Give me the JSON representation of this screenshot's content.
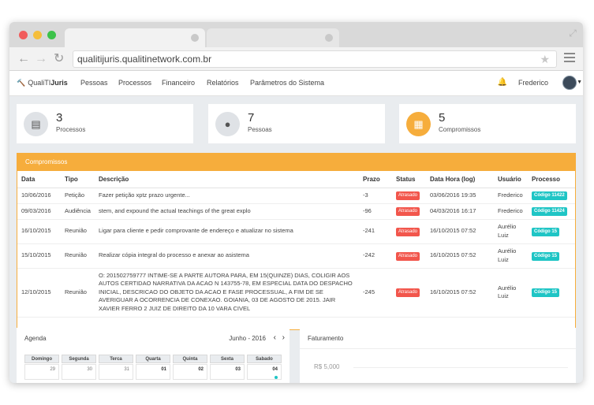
{
  "browser": {
    "url": "qualitijuris.qualitinetwork.com.br"
  },
  "appnav": {
    "brand_prefix": "QualiTI",
    "brand_suffix": "Juris",
    "items": [
      "Pessoas",
      "Processos",
      "Financeiro",
      "Relatórios",
      "Parâmetros do Sistema"
    ],
    "user": "Frederico"
  },
  "cards": [
    {
      "value": "3",
      "label": "Processos",
      "icon": "folder-icon"
    },
    {
      "value": "7",
      "label": "Pessoas",
      "icon": "user-icon"
    },
    {
      "value": "5",
      "label": "Compromissos",
      "icon": "calendar-icon"
    }
  ],
  "compromissos": {
    "title": "Compromissos",
    "columns": [
      "Data",
      "Tipo",
      "Descrição",
      "Prazo",
      "Status",
      "Data Hora (log)",
      "Usuário",
      "Processo"
    ],
    "rows": [
      {
        "data": "10/06/2016",
        "tipo": "Petição",
        "descricao": "Fazer petição xptz prazo urgente...",
        "prazo": "-3",
        "status": "Atrasado",
        "datahora": "03/06/2016 19:35",
        "usuario": "Frederico",
        "processo": "Código 11422"
      },
      {
        "data": "09/03/2016",
        "tipo": "Audiência",
        "descricao": "stem, and expound the actual teachings of the great explo",
        "prazo": "-96",
        "status": "Atrasado",
        "datahora": "04/03/2016 16:17",
        "usuario": "Frederico",
        "processo": "Código 11424"
      },
      {
        "data": "16/10/2015",
        "tipo": "Reunião",
        "descricao": "Ligar para cliente e pedir comprovante de endereço e atualizar no sistema",
        "prazo": "-241",
        "status": "Atrasado",
        "datahora": "16/10/2015 07:52",
        "usuario": "Aurélio Luiz",
        "processo": "Código 15"
      },
      {
        "data": "15/10/2015",
        "tipo": "Reunião",
        "descricao": "Realizar cópia integral do processo e anexar ao asistema",
        "prazo": "-242",
        "status": "Atrasado",
        "datahora": "16/10/2015 07:52",
        "usuario": "Aurélio Luiz",
        "processo": "Código 15"
      },
      {
        "data": "12/10/2015",
        "tipo": "Reunião",
        "descricao": "O: 201502759777 INTIME-SE A PARTE AUTORA PARA, EM 15(QUINZE) DIAS, COLIGIR AOS AUTOS CERTIDAO NARRATIVA DA ACAO N 143755-78, EM ESPECIAL DATA DO DESPACHO INICIAL, DESCRICAO DO OBJETO DA ACAO E FASE PROCESSUAL, A FIM DE SE AVERIGUAR A OCORRENCIA DE CONEXAO. GOIANIA, 03 DE AGOSTO DE 2015. JAIR XAVIER FERRO 2 JUIZ DE DIREITO DA 10 VARA CIVEL",
        "prazo": "-245",
        "status": "Atrasado",
        "datahora": "16/10/2015 07:52",
        "usuario": "Aurélio Luiz",
        "processo": "Código 15"
      }
    ]
  },
  "agenda": {
    "title": "Agenda",
    "month": "Junho - 2016",
    "weekdays": [
      "Domingo",
      "Segunda",
      "Terca",
      "Quarta",
      "Quinta",
      "Sexta",
      "Sabado"
    ],
    "days": [
      "29",
      "30",
      "31",
      "01",
      "02",
      "03",
      "04"
    ]
  },
  "faturamento": {
    "title": "Faturamento",
    "ytick": "R$ 5,000"
  },
  "colors": {
    "accent": "#f6ad3c",
    "danger": "#f2564c",
    "teal": "#1fc5c5",
    "chart_green": "#39b96a"
  }
}
